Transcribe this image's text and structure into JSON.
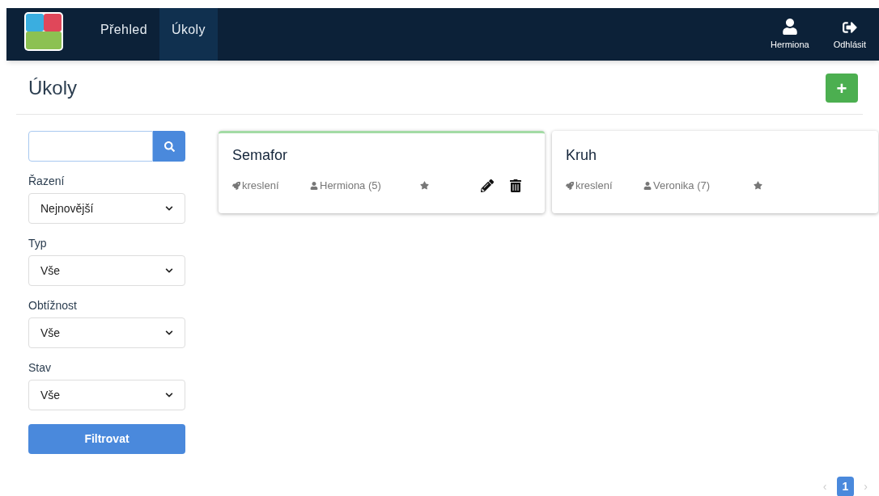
{
  "nav": {
    "items": [
      {
        "label": "Přehled",
        "selected": false
      },
      {
        "label": "Úkoly",
        "selected": true
      }
    ],
    "user": "Hermiona",
    "logout": "Odhlásit"
  },
  "page": {
    "title": "Úkoly",
    "add_button": "+"
  },
  "filters": {
    "selects": [
      {
        "label": "Řazení",
        "value": "Nejnovější"
      },
      {
        "label": "Typ",
        "value": "Vše"
      },
      {
        "label": "Obtížnost",
        "value": "Vše"
      },
      {
        "label": "Stav",
        "value": "Vše"
      }
    ],
    "submit": "Filtrovat"
  },
  "tasks": [
    {
      "title": "Semafor",
      "category": "kreslení",
      "author": "Hermiona (5)",
      "highlighted": true,
      "editable": true
    },
    {
      "title": "Kruh",
      "category": "kreslení",
      "author": "Veronika (7)",
      "highlighted": false,
      "editable": false
    }
  ],
  "pagination": {
    "prev": "‹",
    "next": "›",
    "pages": [
      {
        "label": "1",
        "selected": true
      }
    ]
  }
}
